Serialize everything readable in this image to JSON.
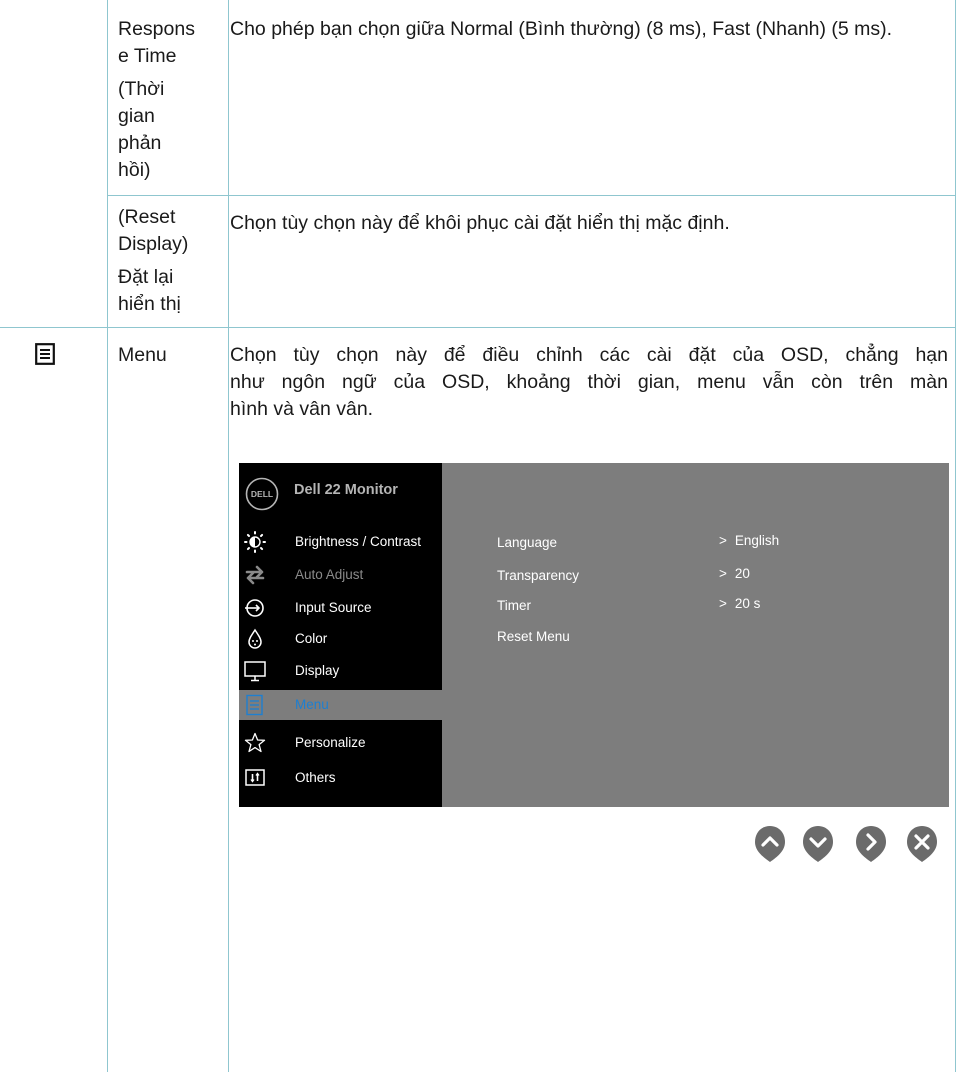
{
  "rows": [
    {
      "label_lines": [
        "Respons",
        "e Time",
        "(Thời",
        "gian",
        "phản",
        "hồi)"
      ],
      "description": "Cho phép bạn chọn giữa Normal (Bình thường) (8 ms), Fast (Nhanh) (5 ms)."
    },
    {
      "label_lines": [
        "(Reset",
        "Display)",
        "Đặt lại",
        "hiển thị"
      ],
      "description": "Chọn tùy chọn này để khôi phục cài đặt hiển thị mặc định."
    },
    {
      "icon": "menu-list-icon",
      "label": "Menu",
      "description_lines": [
        "Chọn tùy chọn này để điều chỉnh các cài đặt của OSD, chẳng hạn",
        "như ngôn ngữ của OSD, khoảng thời gian, menu vẫn còn trên màn",
        "hình và vân vân."
      ]
    }
  ],
  "osd": {
    "logo_text": "DELL",
    "title": "Dell 22 Monitor",
    "menu_items": [
      {
        "label": "Brightness / Contrast",
        "icon": "brightness-icon",
        "state": "normal"
      },
      {
        "label": "Auto Adjust",
        "icon": "auto-adjust-icon",
        "state": "disabled"
      },
      {
        "label": "Input Source",
        "icon": "input-source-icon",
        "state": "normal"
      },
      {
        "label": "Color",
        "icon": "color-icon",
        "state": "normal"
      },
      {
        "label": "Display",
        "icon": "display-icon",
        "state": "normal"
      },
      {
        "label": "Menu",
        "icon": "menu-icon",
        "state": "selected"
      },
      {
        "label": "Personalize",
        "icon": "star-icon",
        "state": "normal"
      },
      {
        "label": "Others",
        "icon": "others-icon",
        "state": "normal"
      }
    ],
    "settings": [
      {
        "label": "Language",
        "value": "English"
      },
      {
        "label": "Transparency",
        "value": "20"
      },
      {
        "label": "Timer",
        "value": "20 s"
      },
      {
        "label": "Reset Menu",
        "value": ""
      }
    ],
    "colors": {
      "panel": "#7d7d7d",
      "sidebar": "#000000",
      "selected_text": "#1e7fd0"
    }
  },
  "nav_buttons": [
    {
      "icon": "up-arrow-icon"
    },
    {
      "icon": "down-arrow-icon"
    },
    {
      "icon": "right-arrow-icon"
    },
    {
      "icon": "close-icon"
    }
  ]
}
